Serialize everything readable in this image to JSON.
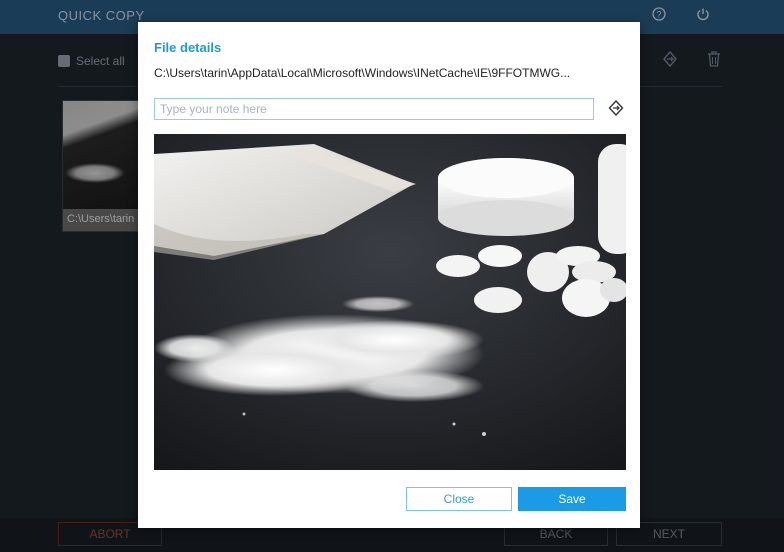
{
  "app": {
    "title": "QUICK COPY",
    "select_all_label": "Select all",
    "thumbnail_label": "C:\\Users\\tarin"
  },
  "footer": {
    "abort_label": "ABORT",
    "back_label": "BACK",
    "next_label": "NEXT"
  },
  "modal": {
    "title": "File details",
    "path": "C:\\Users\\tarin\\AppData\\Local\\Microsoft\\Windows\\INetCache\\IE\\9FFOTMWG...",
    "note_placeholder": "Type your note here",
    "close_label": "Close",
    "save_label": "Save"
  },
  "icons": {
    "help": "question-circle-icon",
    "power": "power-icon",
    "restore": "restore-icon",
    "trash": "trash-icon"
  },
  "colors": {
    "header": "#2a5d86",
    "accent": "#1b9ae6",
    "title": "#1c9ad6",
    "abort": "#a34a3a"
  }
}
